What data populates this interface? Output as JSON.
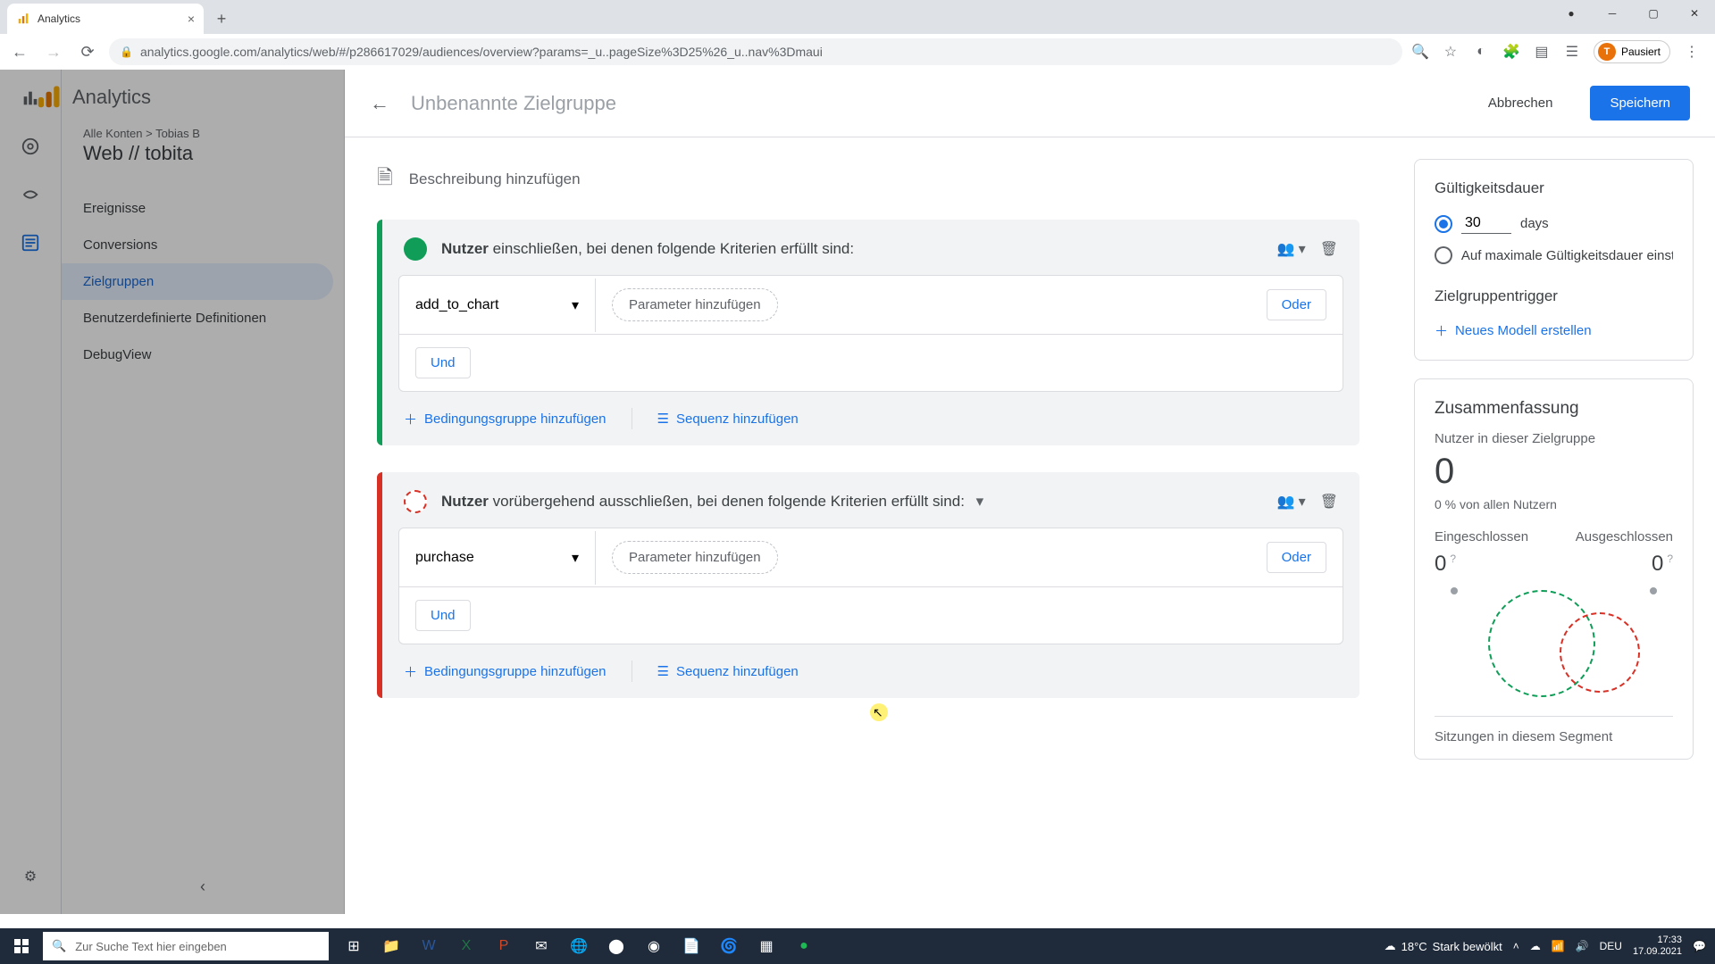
{
  "browser": {
    "tab_title": "Analytics",
    "url": "analytics.google.com/analytics/web/#/p286617029/audiences/overview?params=_u..pageSize%3D25%26_u..nav%3Dmaui",
    "profile_status": "Pausiert",
    "profile_initial": "T"
  },
  "ga": {
    "brand": "Analytics",
    "breadcrumb": "Alle Konten > Tobias B",
    "property": "Web // tobita",
    "menu": {
      "events": "Ereignisse",
      "conversions": "Conversions",
      "audiences": "Zielgruppen",
      "custom_defs": "Benutzerdefinierte Definitionen",
      "debugview": "DebugView"
    }
  },
  "overlay": {
    "title": "Unbenannte Zielgruppe",
    "cancel": "Abbrechen",
    "save": "Speichern",
    "description_placeholder": "Beschreibung hinzufügen",
    "include": {
      "prefix": "Nutzer",
      "text": " einschließen, bei denen folgende Kriterien erfüllt sind:",
      "event": "add_to_chart",
      "add_param": "Parameter hinzufügen",
      "or": "Oder",
      "and": "Und",
      "add_group": "Bedingungsgruppe hinzufügen",
      "add_sequence": "Sequenz hinzufügen"
    },
    "exclude": {
      "prefix": "Nutzer",
      "text": " vorübergehend ausschließen, bei denen folgende Kriterien erfüllt sind:",
      "event": "purchase",
      "add_param": "Parameter hinzufügen",
      "or": "Oder",
      "and": "Und",
      "add_group": "Bedingungsgruppe hinzufügen",
      "add_sequence": "Sequenz hinzufügen"
    }
  },
  "right_panel": {
    "membership_title": "Gültigkeitsdauer",
    "days_value": "30",
    "days_label": "days",
    "max_label": "Auf maximale Gültigkeitsdauer einst",
    "trigger_title": "Zielgruppentrigger",
    "trigger_link": "Neues Modell erstellen",
    "summary_title": "Zusammenfassung",
    "users_label": "Nutzer in dieser Zielgruppe",
    "users_count": "0",
    "users_pct": "0 % von allen Nutzern",
    "included_label": "Eingeschlossen",
    "excluded_label": "Ausgeschlossen",
    "included_count": "0",
    "excluded_count": "0",
    "sessions_label": "Sitzungen in diesem Segment"
  },
  "taskbar": {
    "search_placeholder": "Zur Suche Text hier eingeben",
    "weather_temp": "18°C",
    "weather_text": "Stark bewölkt",
    "lang": "DEU",
    "time": "17:33",
    "date": "17.09.2021"
  }
}
